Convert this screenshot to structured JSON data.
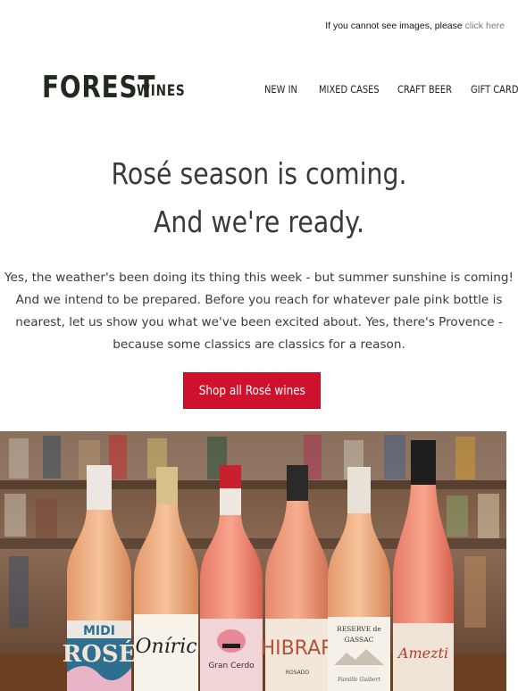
{
  "preheader": {
    "text": "If you cannot see images, please ",
    "link": "click here"
  },
  "logo": {
    "primary": "FOREST",
    "secondary": "WINES"
  },
  "nav": {
    "items": [
      "NEW IN",
      "MIXED CASES",
      "CRAFT BEER",
      "GIFT CARDS"
    ]
  },
  "hero": {
    "headline_line1": "Rosé season is coming.",
    "headline_line2": "And we're ready.",
    "body_lines": [
      "Yes, the weather's been doing its thing this week - but summer sunshine is coming!",
      "And we intend to be prepared. Before you reach for whatever pale pink bottle is",
      "nearest, let us show you what we've been excited about. Yes, there's Provence -",
      "because some classics are classics for a reason."
    ],
    "cta_label": "Shop all Rosé wines"
  },
  "photo": {
    "labels": {
      "b1_top": "MIDI",
      "b1_main": "ROSÉ",
      "b2_main": "Oníric",
      "b3_main": "Gran Cerdo",
      "b4_main": "HIBRAR",
      "b4_sub": "ROSADO",
      "b5_top": "RESERVE de",
      "b5_mid": "GASSAC",
      "b5_sub": "Famille Guibert",
      "b6_main": "Amezti"
    }
  },
  "colors": {
    "cta": "#d0112b",
    "logo": "#22291f",
    "text": "#3a3a3a"
  }
}
